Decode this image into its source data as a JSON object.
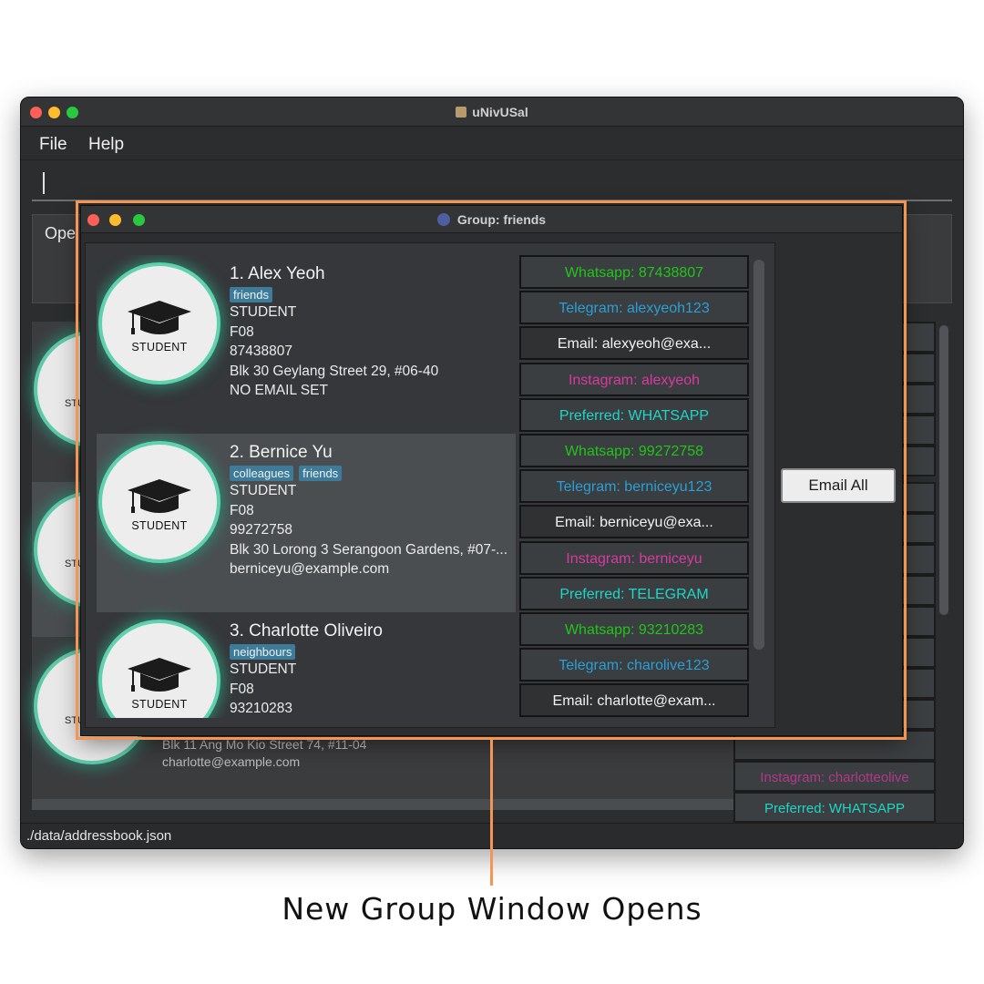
{
  "main_window": {
    "title": "uNivUSal",
    "menu": [
      "File",
      "Help"
    ],
    "result_text": "Ope",
    "status_bar": "./data/addressbook.json",
    "bg_list": {
      "avatar_texts": [
        "STU",
        "STU",
        "STU"
      ],
      "row3_address": "Blk 11 Ang Mo Kio Street 74, #11-04",
      "row3_email": "charlotte@example.com"
    },
    "bg_contacts": {
      "instagram": "Instagram: charlotteolive",
      "preferred": "Preferred: WHATSAPP"
    }
  },
  "group_window": {
    "title": "Group: friends",
    "email_all_label": "Email All",
    "persons": [
      {
        "index_name": "1.  Alex Yeoh",
        "tags": [
          "friends"
        ],
        "avatar_label": "STUDENT",
        "role": "STUDENT",
        "group": "F08",
        "phone": "87438807",
        "address": "Blk 30 Geylang Street 29, #06-40",
        "email": "NO EMAIL SET"
      },
      {
        "index_name": "2.  Bernice Yu",
        "tags": [
          "colleagues",
          "friends"
        ],
        "avatar_label": "STUDENT",
        "role": "STUDENT",
        "group": "F08",
        "phone": "99272758",
        "address": "Blk 30 Lorong 3 Serangoon Gardens, #07-...",
        "email": "berniceyu@example.com"
      },
      {
        "index_name": "3.  Charlotte Oliveiro",
        "tags": [
          "neighbours"
        ],
        "avatar_label": "STUDENT",
        "role": "STUDENT",
        "group": "F08",
        "phone": "93210283"
      }
    ],
    "contacts": [
      {
        "text": "Whatsapp: 87438807",
        "color": "#22c31b"
      },
      {
        "text": "Telegram: alexyeoh123",
        "color": "#2a9fd6"
      },
      {
        "text": "Email: alexyeoh@exa...",
        "color": "#f2f2f2"
      },
      {
        "text": "Instagram: alexyeoh",
        "color": "#d63aa0"
      },
      {
        "text": "Preferred: WHATSAPP",
        "color": "#1fd6c6"
      },
      {
        "text": "Whatsapp: 99272758",
        "color": "#22c31b"
      },
      {
        "text": "Telegram: berniceyu123",
        "color": "#2a9fd6"
      },
      {
        "text": "Email: berniceyu@exa...",
        "color": "#f2f2f2"
      },
      {
        "text": "Instagram: berniceyu",
        "color": "#d63aa0"
      },
      {
        "text": "Preferred: TELEGRAM",
        "color": "#1fd6c6"
      },
      {
        "text": "Whatsapp: 93210283",
        "color": "#22c31b"
      },
      {
        "text": "Telegram: charolive123",
        "color": "#2a9fd6"
      },
      {
        "text": "Email: charlotte@exam...",
        "color": "#f2f2f2"
      }
    ]
  },
  "annotation": {
    "caption": "New Group Window Opens",
    "color": "#f59553"
  }
}
